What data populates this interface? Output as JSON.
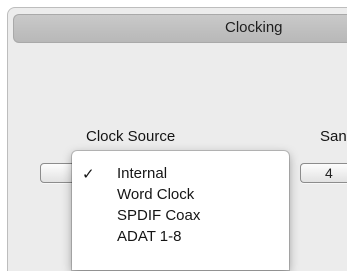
{
  "section": {
    "title": "Clocking"
  },
  "clock_source": {
    "label": "Clock Source",
    "menu": {
      "items": [
        {
          "label": "Internal",
          "checked": true,
          "check_glyph": "✓"
        },
        {
          "label": "Word Clock",
          "checked": false,
          "check_glyph": ""
        },
        {
          "label": "SPDIF Coax",
          "checked": false,
          "check_glyph": ""
        },
        {
          "label": "ADAT 1-8",
          "checked": false,
          "check_glyph": ""
        }
      ]
    }
  },
  "sample_rate": {
    "label": "San",
    "value": "4"
  },
  "colors": {
    "panel_bg": "#ececec",
    "header_bg": "#c0c0c0",
    "menu_bg": "#ffffff"
  }
}
